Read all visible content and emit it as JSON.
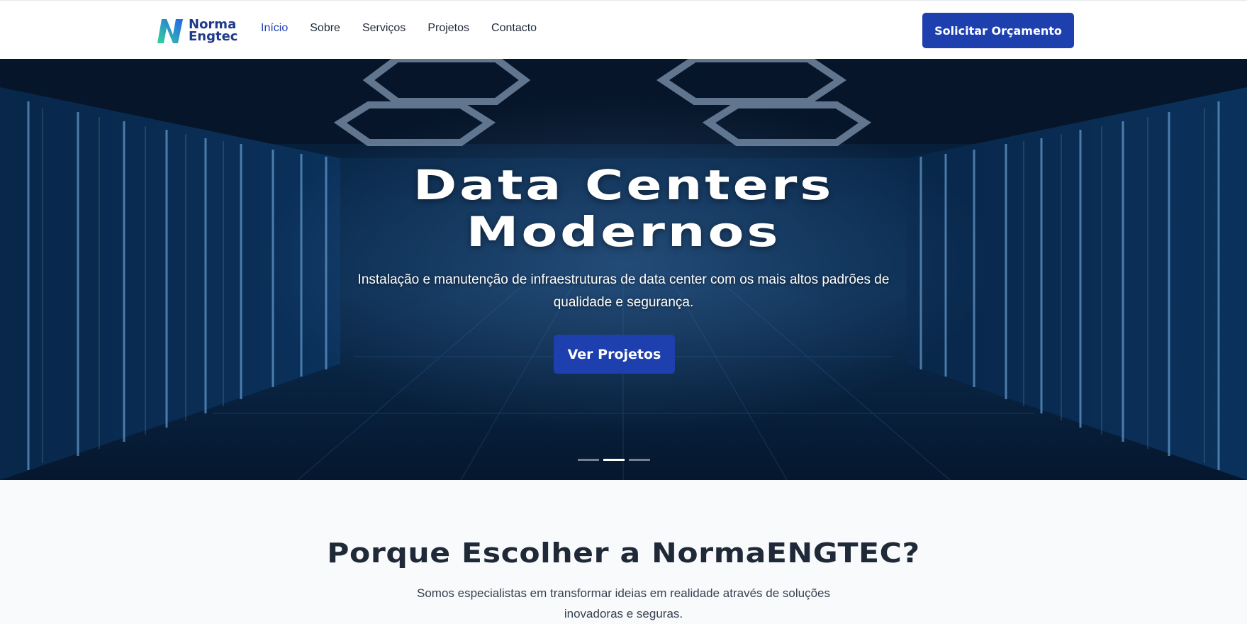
{
  "header": {
    "logo": {
      "line1": "Norma",
      "line2": "Engtec"
    },
    "nav": [
      {
        "label": "Início",
        "active": true
      },
      {
        "label": "Sobre",
        "active": false
      },
      {
        "label": "Serviços",
        "active": false
      },
      {
        "label": "Projetos",
        "active": false
      },
      {
        "label": "Contacto",
        "active": false
      }
    ],
    "cta_label": "Solicitar Orçamento"
  },
  "hero": {
    "title_line1": "Data Centers",
    "title_line2": "Modernos",
    "subtitle": "Instalação e manutenção de infraestruturas de data center com os mais altos padrões de qualidade e segurança.",
    "cta_label": "Ver Projetos",
    "slides_total": 3,
    "active_slide": 2
  },
  "why": {
    "title": "Porque Escolher a NormaENGTEC?",
    "subtitle": "Somos especialistas em transformar ideias em realidade através de soluções inovadoras e seguras."
  },
  "colors": {
    "brand": "#1e40af",
    "brand_dark": "#1e3a8a",
    "logo_gradient_start": "#34d399",
    "logo_gradient_end": "#2563eb",
    "hero_base": "#0b2a4c",
    "section_bg": "#f8fafc"
  }
}
